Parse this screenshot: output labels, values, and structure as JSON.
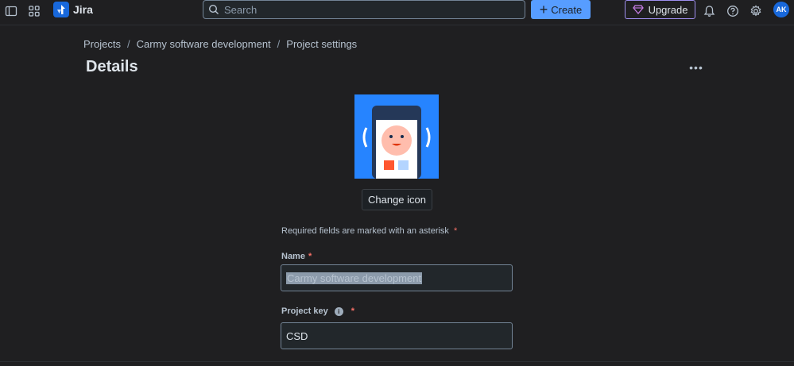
{
  "topbar": {
    "app_name": "Jira",
    "search_placeholder": "Search",
    "create_label": "Create",
    "upgrade_label": "Upgrade",
    "avatar_initials": "AK"
  },
  "breadcrumb": {
    "items": [
      "Projects",
      "Carmy software development",
      "Project settings"
    ],
    "separator": "/"
  },
  "page": {
    "title": "Details",
    "more_label": "•••"
  },
  "project_icon": {
    "change_label": "Change icon",
    "bg_color": "#2684ff"
  },
  "form": {
    "required_note": "Required fields are marked with an asterisk",
    "asterisk": "*",
    "name_label": "Name",
    "name_value": "Carmy software development",
    "key_label": "Project key",
    "key_value": "CSD"
  },
  "colors": {
    "accent": "#579dff",
    "upgrade_border": "#9f8fef",
    "required": "#f87168"
  }
}
